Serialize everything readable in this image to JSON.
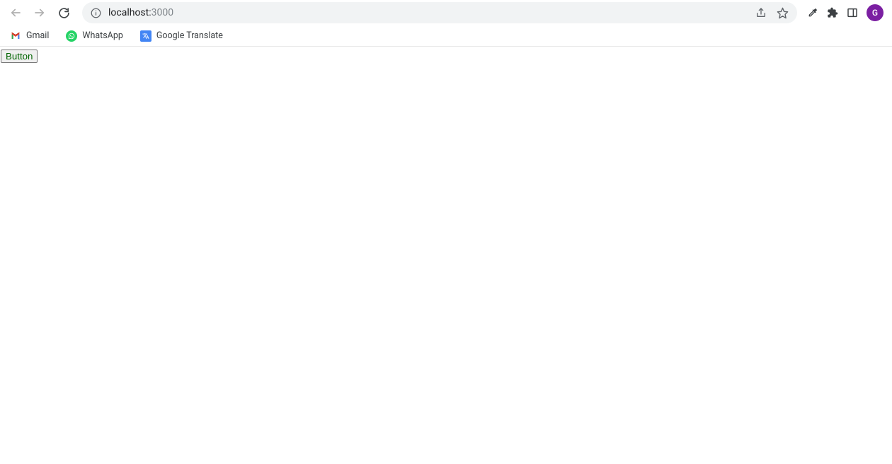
{
  "toolbar": {
    "url_host": "localhost:",
    "url_port": "3000"
  },
  "bookmarks": [
    {
      "label": "Gmail"
    },
    {
      "label": "WhatsApp"
    },
    {
      "label": "Google Translate"
    }
  ],
  "profile": {
    "initial": "G"
  },
  "page": {
    "button_label": "Button"
  }
}
